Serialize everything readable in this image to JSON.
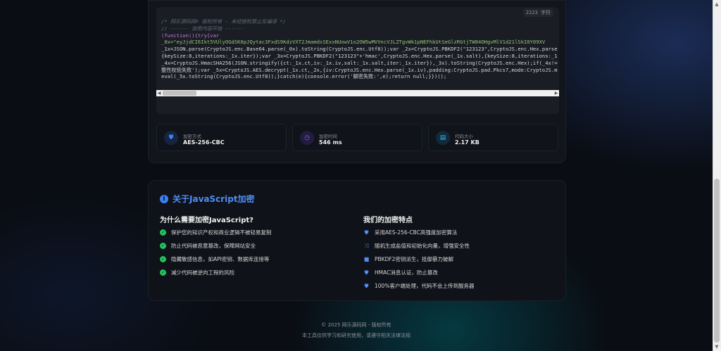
{
  "code_panel": {
    "char_count": "2223 字符",
    "lines": [
      {
        "cls": "c-comment",
        "text": "/* 网乐源码网© 版权所有 - 未经授权禁止反编译 */"
      },
      {
        "cls": "c-comment",
        "text": "// ------ 加密内容开始 ------"
      },
      {
        "cls": "c-kw",
        "text": "(function(){try{var"
      },
      {
        "cls": "c-str",
        "text": "_0x=\"eyJjdCI6Ikt5VUlyOGdSK0pJQytac3FxdS9KdzVXT2JmamdsSExxNUowV1o2OW5wMVVncVJLZTgvWk1pNEFhbUtSeGlzRGtjTW84OHgvMlV1d21lSkI0Y09XV"
      },
      {
        "cls": "",
        "text": "_1x=JSON.parse(CryptoJS.enc.Base64.parse(_0x).toString(CryptoJS.enc.Utf8));var _2x=CryptoJS.PBKDF2(\"123123\",CryptoJS.enc.Hex.parse(_1x.salt),"
      },
      {
        "cls": "",
        "text": "{keySize:8,iterations:_1x.iter});var _3x=CryptoJS.PBKDF2(\"123123\"+'hmac',CryptoJS.enc.Hex.parse(_1x.salt),{keySize:8,iterations:_1x.iter});var"
      },
      {
        "cls": "",
        "text": "_4x=CryptoJS.HmacSHA256(JSON.stringify({ct:_1x.ct,iv:_1x.iv,salt:_1x.salt,iter:_1x.iter}),_3x).toString(CryptoJS.enc.Hex);if(_4x!==_1x.hmac)throw new Error('完"
      },
      {
        "cls": "",
        "text": "整性校验失败');var _5x=CryptoJS.AES.decrypt(_1x.ct,_2x,{iv:CryptoJS.enc.Hex.parse(_1x.iv),padding:CryptoJS.pad.Pkcs7,mode:CryptoJS.mode.CBC});return"
      },
      {
        "cls": "",
        "text": "eval(_5x.toString(CryptoJS.enc.Utf8));}catch(e){console.error('解密失败:',e);return null;}})();"
      }
    ]
  },
  "stats": [
    {
      "label": "加密方式",
      "value": "AES-256-CBC",
      "icon": "shield-icon",
      "color": "#3b82f6",
      "bg": "#172440"
    },
    {
      "label": "加密时间",
      "value": "546 ms",
      "icon": "clock-icon",
      "color": "#8b5cf6",
      "bg": "#221d3d"
    },
    {
      "label": "代码大小",
      "value": "2.17 KB",
      "icon": "file-icon",
      "color": "#38bdf8",
      "bg": "#102a3a"
    }
  ],
  "about": {
    "title": "关于JavaScript加密",
    "why": {
      "title": "为什么需要加密JavaScript?",
      "items": [
        "保护您的知识产权和商业逻辑不被轻易复制",
        "防止代码被恶意篡改，保障网站安全",
        "隐藏敏感信息，如API密钥、数据库连接等",
        "减少代码被逆向工程的风险"
      ]
    },
    "features": {
      "title": "我们的加密特点",
      "items": [
        {
          "text": "采用AES-256-CBC高强度加密算法",
          "icon": "shield-icon"
        },
        {
          "text": "随机生成盐值和初始化向量，增强安全性",
          "icon": "shuffle-icon"
        },
        {
          "text": "PBKDF2密钥派生，抵御暴力破解",
          "icon": "lock-icon"
        },
        {
          "text": "HMAC消息认证，防止篡改",
          "icon": "shield-icon"
        },
        {
          "text": "100%客户端处理，代码不会上传到服务器",
          "icon": "shield-icon"
        }
      ]
    }
  },
  "footer": {
    "copyright": "© 2025 网乐源码网 - 版权所有",
    "notice": "本工具仅供学习和研究使用，请遵守相关法律法规"
  }
}
